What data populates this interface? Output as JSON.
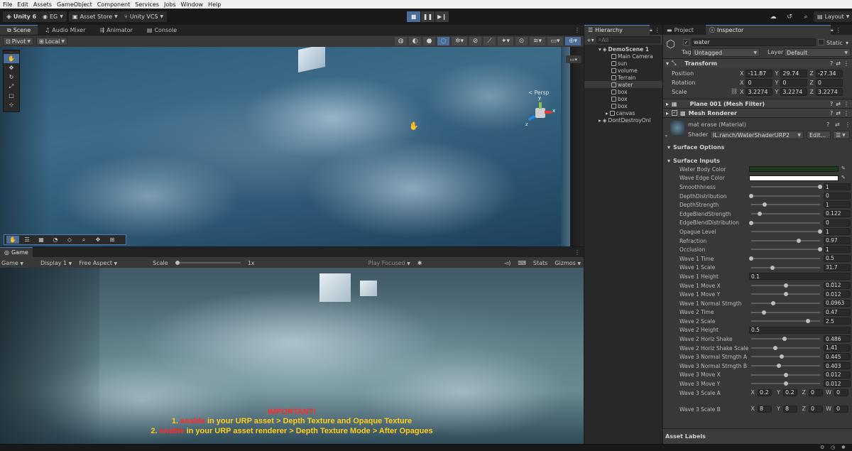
{
  "menu": [
    "File",
    "Edit",
    "Assets",
    "GameObject",
    "Component",
    "Services",
    "Jobs",
    "Window",
    "Help"
  ],
  "toolbar": {
    "unity_label": "Unity 6",
    "account": "EG",
    "asset_store": "Asset Store",
    "vcs": "Unity VCS",
    "layout": "Layout"
  },
  "scene_tabs": [
    "Scene",
    "Audio Mixer",
    "Animator",
    "Console"
  ],
  "scene_controls": {
    "pivot": "Pivot",
    "local": "Local"
  },
  "gizmo": {
    "y": "y",
    "x": "x",
    "z": "z",
    "persp": "< Persp"
  },
  "game_tab": "Game",
  "game_controls": {
    "mode": "Game",
    "display": "Display 1",
    "aspect": "Free Aspect",
    "scale_label": "Scale",
    "scale_value": "1x",
    "play_focused": "Play Focused",
    "stats": "Stats",
    "gizmos": "Gizmos"
  },
  "note": {
    "title": "IMPORTANT!",
    "line1_prefix": "1. ",
    "line1_em": "enable",
    "line1_rest": " in your URP asset > Depth Texture and Opaque Texture",
    "line2_prefix": "2. ",
    "line2_em": "enable",
    "line2_rest": " in your URP asset renderer > Depth Texture Mode > After Opagues"
  },
  "hierarchy": {
    "tab": "Hierarchy",
    "search_placeholder": "All",
    "scene": "DemoScene 1",
    "items": [
      "Main Camera",
      "sun",
      "volume",
      "Terrain",
      "water",
      "box",
      "box",
      "box",
      "canvas"
    ],
    "dontdestroy": "DontDestroyOnl"
  },
  "inspector": {
    "tabs": [
      "Project",
      "Inspector"
    ],
    "object_name": "water",
    "static": "Static",
    "tag_label": "Tag",
    "tag": "Untagged",
    "layer_label": "Layer",
    "layer": "Default",
    "transform": {
      "title": "Transform",
      "position_label": "Position",
      "rotation_label": "Rotation",
      "scale_label": "Scale",
      "position": [
        "-11.87",
        "29.74",
        "-27.34"
      ],
      "rotation": [
        "0",
        "0",
        "0"
      ],
      "scale": [
        "3.2274",
        "3.2274",
        "3.2274"
      ]
    },
    "mesh_filter": "Plane 001 (Mesh Filter)",
    "mesh_renderer": "Mesh Renderer",
    "material": "mat erase (Material)",
    "shader_label": "Shader",
    "shader": "IL.ranch/WaterShaderURP2",
    "edit": "Edit...",
    "surface_options": "Surface Options",
    "surface_inputs": "Surface Inputs",
    "props": [
      {
        "label": "Water Body Color",
        "type": "color",
        "color": "#1d3a1f"
      },
      {
        "label": "Wave Edge Color",
        "type": "color",
        "color": "#ffffff"
      },
      {
        "label": "Smoothhness",
        "type": "slider",
        "value": "1",
        "t": 1.0
      },
      {
        "label": "DepthDistribution",
        "type": "slider",
        "value": "0",
        "t": 0.0
      },
      {
        "label": "DepthStrength",
        "type": "slider",
        "value": "1",
        "t": 0.2
      },
      {
        "label": "EdgeBlendStrength",
        "type": "slider",
        "value": "0.122",
        "t": 0.12
      },
      {
        "label": "EdgeBlendDistribution",
        "type": "slider",
        "value": "0",
        "t": 0.0
      },
      {
        "label": "Opague Level",
        "type": "slider",
        "value": "1",
        "t": 1.0
      },
      {
        "label": "Refraction",
        "type": "slider",
        "value": "0.97",
        "t": 0.69
      },
      {
        "label": "Occlusion",
        "type": "slider",
        "value": "1",
        "t": 1.0
      },
      {
        "label": "Wave 1 Time",
        "type": "slider",
        "value": "0.5",
        "t": 0.0
      },
      {
        "label": "Wave 1 Scale",
        "type": "slider",
        "value": "31.7",
        "t": 0.31
      },
      {
        "label": "Wave 1 Height",
        "type": "field",
        "value": "0.1"
      },
      {
        "label": "Wave 1 Move X",
        "type": "slider",
        "value": "0.012",
        "t": 0.51
      },
      {
        "label": "Wave 1 Move Y",
        "type": "slider",
        "value": "0.012",
        "t": 0.51
      },
      {
        "label": "Wave 1 Normal Strngth",
        "type": "slider",
        "value": "0.0963",
        "t": 0.32
      },
      {
        "label": "Wave 2 Time",
        "type": "slider",
        "value": "0.47",
        "t": 0.19
      },
      {
        "label": "Wave 2 Scale",
        "type": "slider",
        "value": "2.5",
        "t": 0.82
      },
      {
        "label": "Wave 2 Height",
        "type": "field",
        "value": "0.5"
      },
      {
        "label": "Wave 2 Horiz Shake",
        "type": "slider",
        "value": "0.486",
        "t": 0.48
      },
      {
        "label": "Wave 2 Horiz Shake Scale",
        "type": "slider",
        "value": "1.41",
        "t": 0.35
      },
      {
        "label": "Wave 3 Normal Strngth A",
        "type": "slider",
        "value": "0.445",
        "t": 0.44
      },
      {
        "label": "Wave 3 Normal Strngth B",
        "type": "slider",
        "value": "0.403",
        "t": 0.4
      },
      {
        "label": "Wave 3 Move X",
        "type": "slider",
        "value": "0.012",
        "t": 0.51
      },
      {
        "label": "Wave 3 Move Y",
        "type": "slider",
        "value": "0.012",
        "t": 0.51
      }
    ],
    "scale_a_label": "Wave 3 Scale A",
    "scale_a": [
      "0.2",
      "0.2",
      "0",
      "0"
    ],
    "scale_b_label": "Wave 3 Scale B",
    "scale_b": [
      "8",
      "8",
      "0",
      "0"
    ],
    "asset_labels": "Asset Labels"
  }
}
